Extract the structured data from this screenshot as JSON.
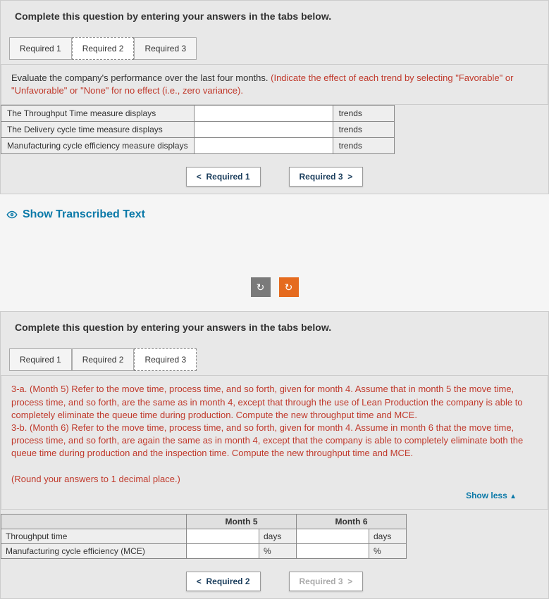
{
  "panel1": {
    "header": "Complete this question by entering your answers in the tabs below.",
    "tabs": [
      "Required 1",
      "Required 2",
      "Required 3"
    ],
    "activeTab": 1,
    "instructionMain": "Evaluate the company's performance over the last four months. ",
    "instructionRed": "(Indicate the effect of each trend by selecting \"Favorable\" or \"Unfavorable\" or \"None\" for no effect (i.e., zero variance).",
    "rows": [
      {
        "label": "The Throughput Time measure displays",
        "suffix": "trends"
      },
      {
        "label": "The Delivery cycle time measure displays",
        "suffix": "trends"
      },
      {
        "label": "Manufacturing cycle efficiency measure displays",
        "suffix": "trends"
      }
    ],
    "navPrev": "Required 1",
    "navNext": "Required 3"
  },
  "showTranscribed": "Show Transcribed Text",
  "panel2": {
    "header": "Complete this question by entering your answers in the tabs below.",
    "tabs": [
      "Required 1",
      "Required 2",
      "Required 3"
    ],
    "activeTab": 2,
    "paragraph1": "3-a. (Month 5) Refer to the move time, process time, and so forth, given for month 4. Assume that in month 5 the move time, process time, and so forth, are the same as in month 4, except that through the use of Lean Production the company is able to completely eliminate the queue time during production. Compute the new throughput time and MCE.",
    "paragraph2": "3-b. (Month 6) Refer to the move time, process time, and so forth, given for month 4. Assume in month 6 that the move time, process time, and so forth, are again the same as in month 4, except that the company is able to completely eliminate both the queue time during production and the inspection time. Compute the new throughput time and MCE.",
    "roundNote": "(Round your answers to 1 decimal place.)",
    "showLess": "Show less",
    "monthHeaders": [
      "Month 5",
      "Month 6"
    ],
    "rowLabels": [
      "Throughput time",
      "Manufacturing cycle efficiency (MCE)"
    ],
    "units": [
      "days",
      "%"
    ],
    "navPrev": "Required 2",
    "navNext": "Required 3"
  }
}
